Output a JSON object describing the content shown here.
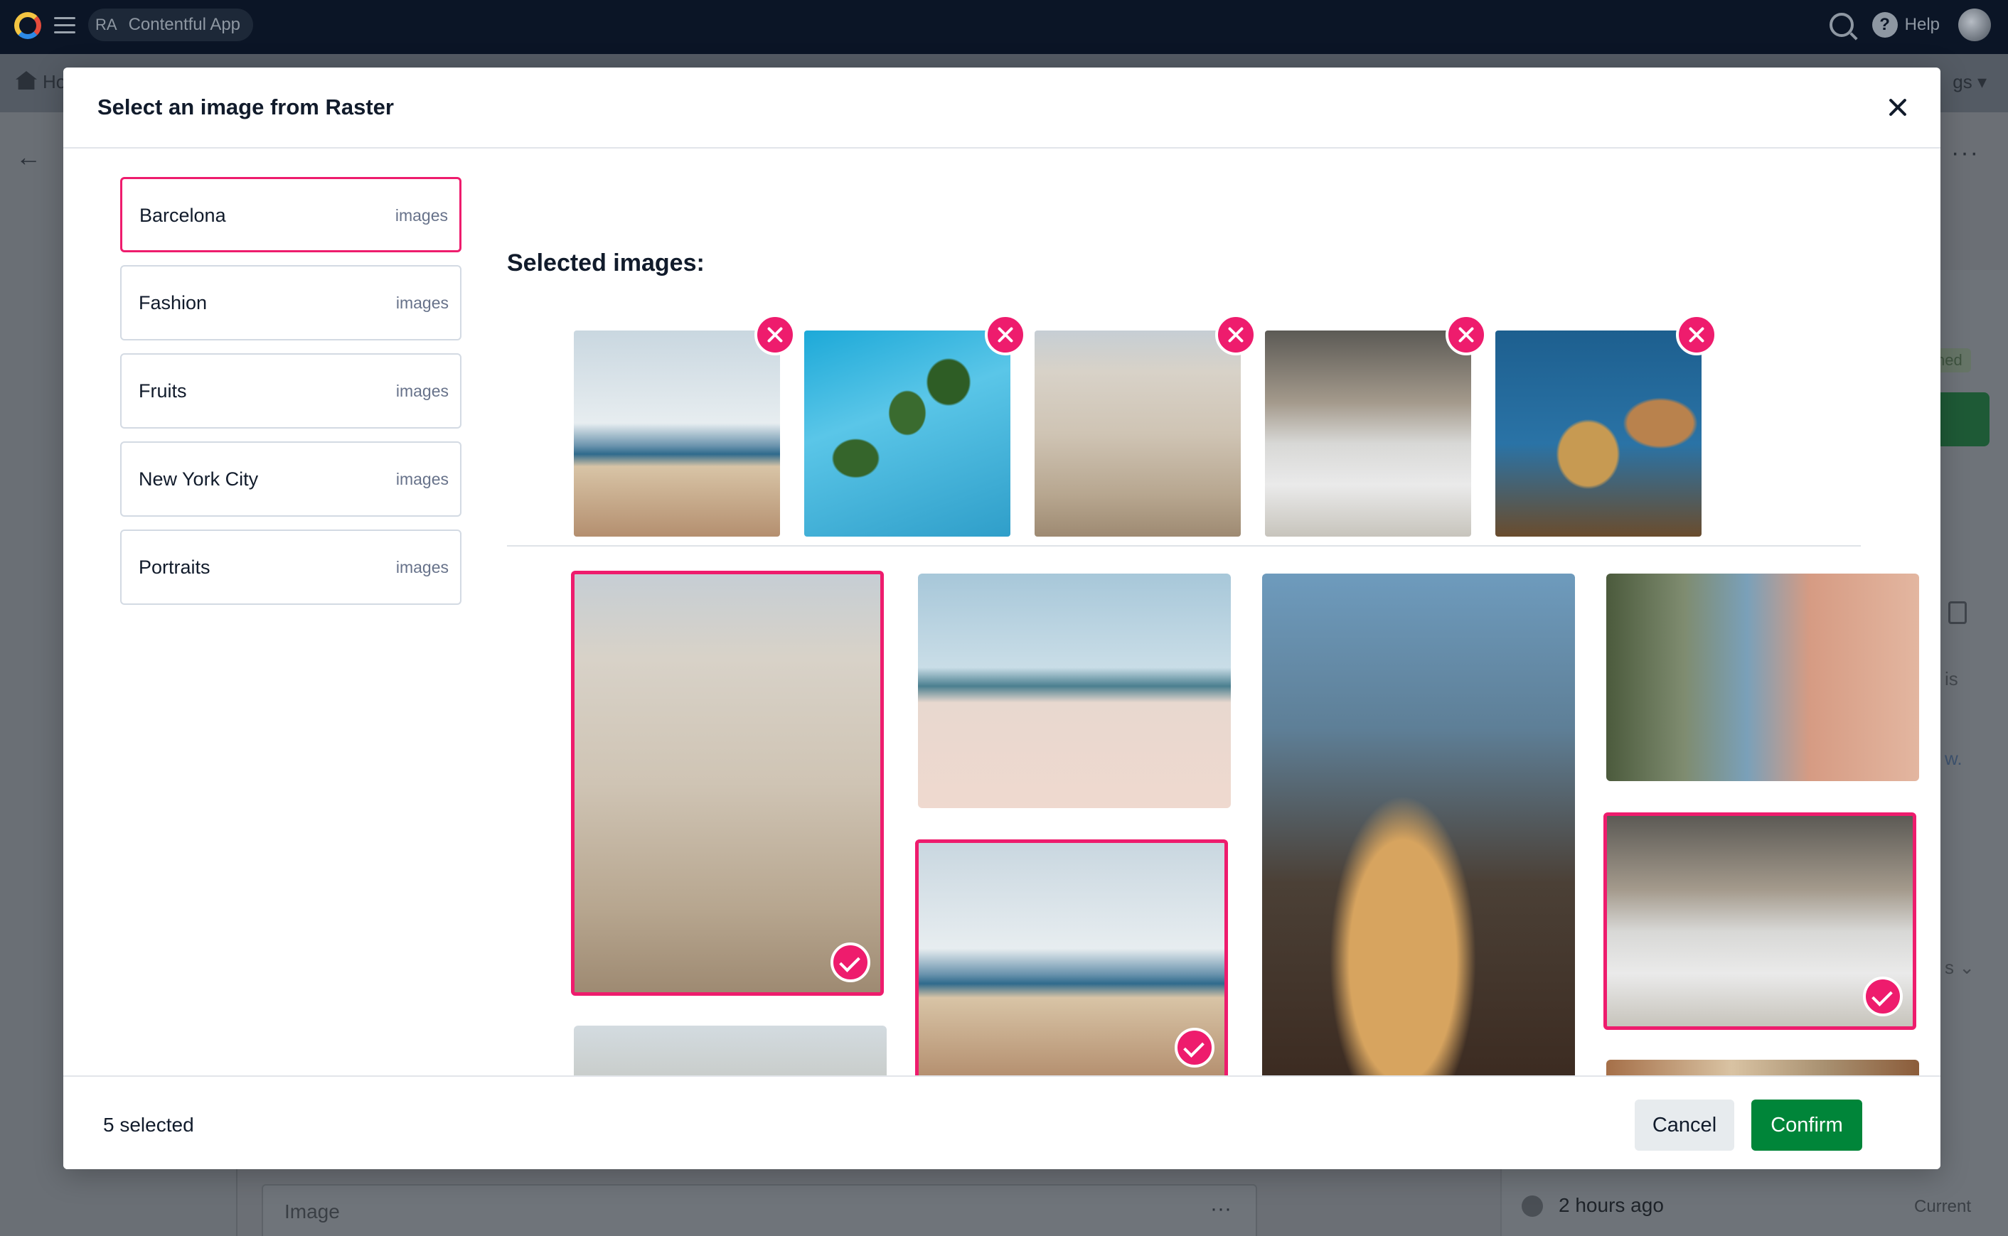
{
  "topbar": {
    "space_initials": "RA",
    "space_name": "Contentful App",
    "help_label": "Help"
  },
  "subbar": {
    "home_label": "Ho",
    "settings_label": "gs ▾"
  },
  "background": {
    "status_badge": "shed",
    "text_a": "is",
    "text_b": "w.",
    "text_c": "s ⌄",
    "field_label": "Image",
    "field_menu": "···",
    "time": "2 hours ago",
    "current_label": "Current",
    "back_icon": "←",
    "more_icon": "···"
  },
  "modal": {
    "title": "Select an image from Raster",
    "close_icon": "close-icon",
    "folders": [
      {
        "name": "Barcelona",
        "type": "images",
        "active": true
      },
      {
        "name": "Fashion",
        "type": "images",
        "active": false
      },
      {
        "name": "Fruits",
        "type": "images",
        "active": false
      },
      {
        "name": "New York City",
        "type": "images",
        "active": false
      },
      {
        "name": "Portraits",
        "type": "images",
        "active": false
      }
    ],
    "selected_heading": "Selected images:",
    "selected_images": [
      "beach-crowd",
      "palm-trees-sky",
      "church-facade",
      "street-musicians",
      "gaudi-rooftop"
    ],
    "grid_images": [
      {
        "id": "church-facade",
        "selected": true
      },
      {
        "id": "palm-beach",
        "selected": false
      },
      {
        "id": "casa-batllo",
        "selected": false
      },
      {
        "id": "colorful-street",
        "selected": false
      },
      {
        "id": "beach-crowd",
        "selected": true
      },
      {
        "id": "street-musicians",
        "selected": true
      },
      {
        "id": "sagrada-familia-street",
        "selected": false
      },
      {
        "id": "market-stall",
        "selected": false
      },
      {
        "id": "city-view",
        "selected": false
      },
      {
        "id": "old-building",
        "selected": false
      }
    ],
    "selected_count_text": "5 selected",
    "cancel_label": "Cancel",
    "confirm_label": "Confirm",
    "colors": {
      "accent": "#ee1c6d",
      "confirm": "#008539"
    }
  }
}
